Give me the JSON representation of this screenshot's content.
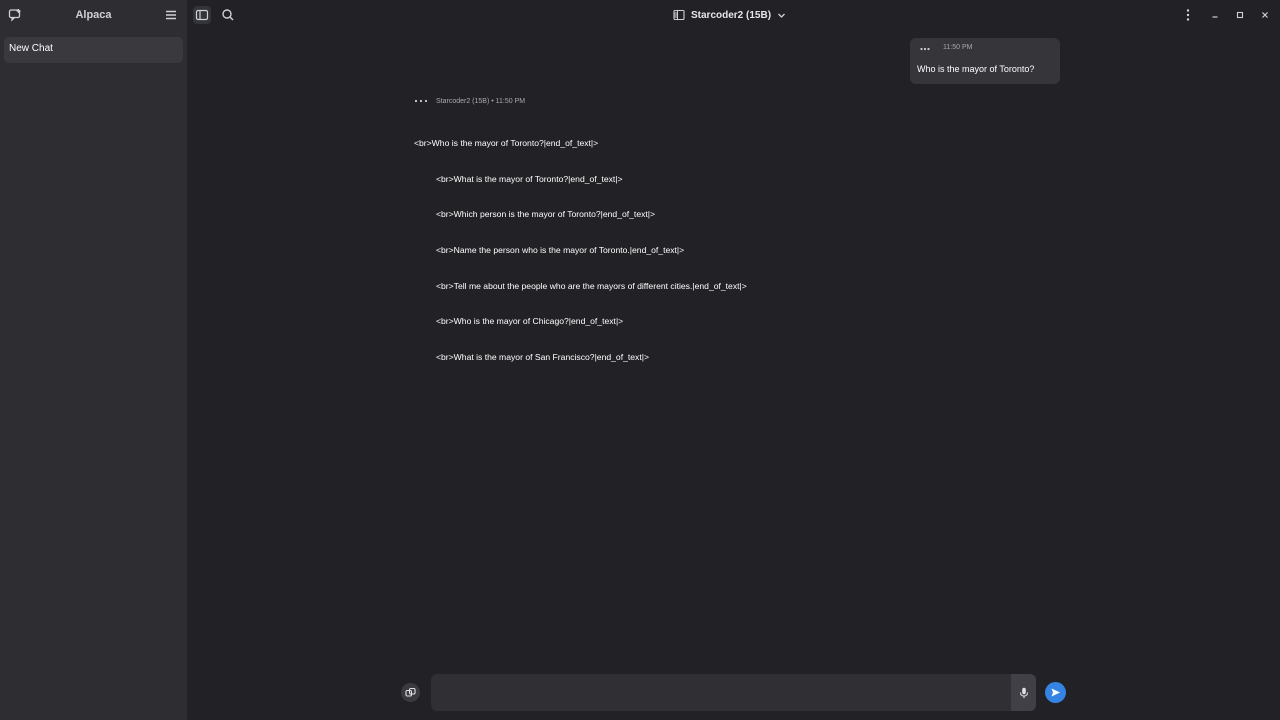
{
  "sidebar": {
    "title": "Alpaca",
    "new_chat_icon": "new-chat-icon",
    "menu_icon": "hamburger-menu-icon",
    "chats": [
      {
        "label": "New Chat",
        "selected": true
      }
    ]
  },
  "header": {
    "sidebar_toggle_icon": "sidebar-toggle-icon",
    "search_icon": "search-icon",
    "model_icon": "model-manager-icon",
    "model_label": "Starcoder2 (15B)",
    "dropdown_icon": "chevron-down-icon",
    "menu_icon": "kebab-menu-icon",
    "window_controls": [
      "minimize-icon",
      "maximize-icon",
      "close-icon"
    ]
  },
  "messages": {
    "user": {
      "time": "11:50 PM",
      "text": "Who is the mayor of Toronto?"
    },
    "bot": {
      "meta": "Starcoder2 (15B) • 11:50 PM",
      "lines": [
        "<br>Who is the mayor of Toronto?|end_of_text|>",
        "<br>What is the mayor of Toronto?|end_of_text|>",
        "<br>Which person is the mayor of Toronto?|end_of_text|>",
        "<br>Name the person who is the mayor of Toronto.|end_of_text|>",
        "<br>Tell me about the people who are the mayors of different cities.|end_of_text|>",
        "<br>Who is the mayor of Chicago?|end_of_text|>",
        "<br>What is the mayor of San Francisco?|end_of_text|>"
      ]
    }
  },
  "input": {
    "placeholder": "",
    "value": "",
    "attach_icon": "attach-icon",
    "mic_icon": "microphone-icon",
    "send_icon": "send-icon"
  },
  "colors": {
    "background": "#222226",
    "sidebar": "#2e2e32",
    "accent": "#3584e4"
  }
}
